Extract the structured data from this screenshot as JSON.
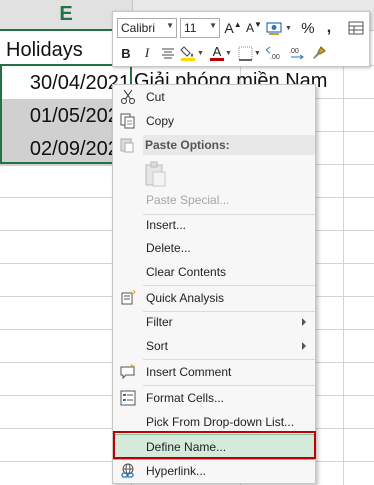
{
  "sheet": {
    "column_letter": "E",
    "cells": [
      "Holidays",
      "30/04/2021",
      "01/05/2021",
      "02/09/2021"
    ],
    "overflow_text": "Giải phóng miền Nam"
  },
  "mini_toolbar": {
    "font_name": "Calibri",
    "font_size": "11",
    "bold": "B",
    "italic": "I",
    "percent": "%",
    "comma": ",",
    "increase_font": "A",
    "decrease_font": "A",
    "font_color_letter": "A",
    "accent_font_color": "#c00000",
    "accent_fill_color": "#ffd800"
  },
  "context_menu": {
    "items": [
      {
        "label": "Cut",
        "icon": "scissors-icon",
        "enabled": true
      },
      {
        "label": "Copy",
        "icon": "copy-icon",
        "enabled": true
      },
      {
        "label": "Paste Options:",
        "icon": "paste-icon",
        "enabled": false
      },
      {
        "label": "Paste Special...",
        "icon": "",
        "enabled": false
      },
      {
        "label": "Insert...",
        "icon": "",
        "enabled": true
      },
      {
        "label": "Delete...",
        "icon": "",
        "enabled": true
      },
      {
        "label": "Clear Contents",
        "icon": "",
        "enabled": true
      },
      {
        "label": "Quick Analysis",
        "icon": "quick-analysis-icon",
        "enabled": true
      },
      {
        "label": "Filter",
        "icon": "",
        "enabled": true,
        "submenu": true
      },
      {
        "label": "Sort",
        "icon": "",
        "enabled": true,
        "submenu": true
      },
      {
        "label": "Insert Comment",
        "icon": "comment-icon",
        "enabled": true
      },
      {
        "label": "Format Cells...",
        "icon": "format-cells-icon",
        "enabled": true
      },
      {
        "label": "Pick From Drop-down List...",
        "icon": "",
        "enabled": true
      },
      {
        "label": "Define Name...",
        "icon": "",
        "enabled": true,
        "highlighted": true
      },
      {
        "label": "Hyperlink...",
        "icon": "hyperlink-icon",
        "enabled": true
      }
    ]
  },
  "colors": {
    "excel_green": "#217346",
    "highlight_bg": "#d4eadb",
    "annotation_red": "#c00000"
  }
}
